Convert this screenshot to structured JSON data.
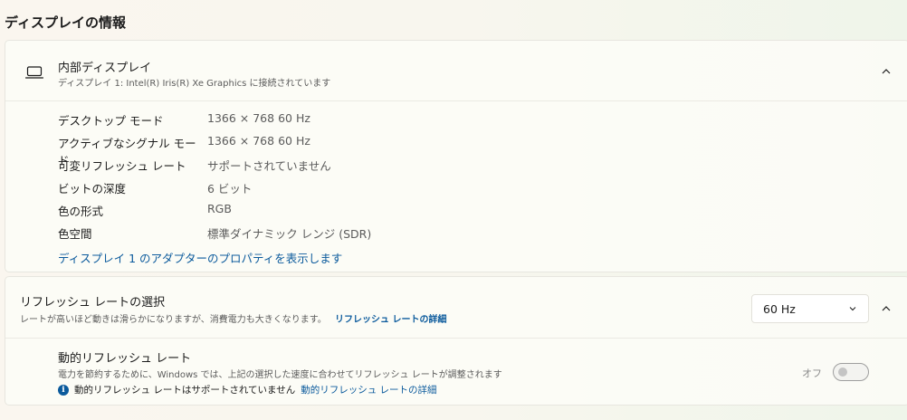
{
  "page": {
    "title": "ディスプレイの情報"
  },
  "display": {
    "title": "内部ディスプレイ",
    "subtitle": "ディスプレイ 1: Intel(R) Iris(R) Xe Graphics に接続されています",
    "properties": [
      {
        "label": "デスクトップ モード",
        "value": "1366 × 768 60 Hz"
      },
      {
        "label": "アクティブなシグナル モード",
        "value": "1366 × 768 60 Hz"
      },
      {
        "label": "可変リフレッシュ レート",
        "value": "サポートされていません"
      },
      {
        "label": "ビットの深度",
        "value": "6 ビット"
      },
      {
        "label": "色の形式",
        "value": "RGB"
      },
      {
        "label": "色空間",
        "value": "標準ダイナミック レンジ (SDR)"
      }
    ],
    "adapter_link": "ディスプレイ 1 のアダプターのプロパティを表示します",
    "expanded": true
  },
  "refresh_rate": {
    "title": "リフレッシュ レートの選択",
    "description": "レートが高いほど動きは滑らかになりますが、消費電力も大きくなります。",
    "details_link": "リフレッシュ レートの詳細",
    "selected": "60 Hz",
    "expanded": true
  },
  "dynamic_refresh": {
    "title": "動的リフレッシュ レート",
    "description": "電力を節約するために、Windows では、上記の選択した速度に合わせてリフレッシュ レートが調整されます",
    "info_text": "動的リフレッシュ レートはサポートされていません",
    "details_link": "動的リフレッシュ レートの詳細",
    "toggle_label": "オフ",
    "toggle_on": false
  },
  "colors": {
    "accent": "#0b5a9c",
    "text": "#1b1b1b",
    "secondary_text": "#5b5b5b"
  },
  "icons": {
    "display": "laptop-icon",
    "collapse": "chevron-up-icon",
    "dropdown": "chevron-down-icon",
    "info": "info-icon"
  }
}
